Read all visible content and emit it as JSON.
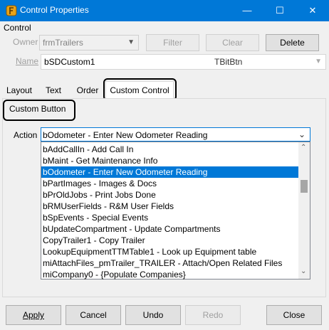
{
  "window": {
    "title": "Control Properties",
    "controls": {
      "minimize": "—",
      "maximize": "☐",
      "close": "✕"
    }
  },
  "control_group": {
    "label": "Control",
    "owner_label": "Owner",
    "owner_value": "frmTrailers",
    "filter_label": "Filter",
    "clear_label": "Clear",
    "delete_label": "Delete",
    "name_label": "Name",
    "name_value": "bSDCustom1",
    "type_value": "TBitBtn"
  },
  "tabs": [
    {
      "label": "Layout"
    },
    {
      "label": "Text"
    },
    {
      "label": "Order"
    },
    {
      "label": "Custom Control",
      "active": true
    }
  ],
  "custom": {
    "group_label": "Custom Button",
    "action_label": "Action",
    "action_value": "bOdometer - Enter New Odometer Reading",
    "options": [
      "bAddCallIn - Add Call In",
      "bMaint - Get Maintenance Info",
      "bOdometer - Enter New Odometer Reading",
      "bPartImages - Images & Docs",
      "bPrOldJobs - Print Jobs Done",
      "bRMUserFields - R&M User Fields",
      "bSpEvents - Special Events",
      "bUpdateCompartment - Update Compartments",
      "CopyTrailer1 - Copy Trailer",
      "LookupEquipmentTTMTable1 - Look up Equipment table",
      "miAttachFiles_pmTrailer_TRAILER - Attach/Open Related Files",
      "miCompany0 - {Populate Companies}"
    ],
    "selected_index": 2
  },
  "footer": {
    "apply_label": "Apply",
    "cancel_label": "Cancel",
    "undo_label": "Undo",
    "redo_label": "Redo",
    "close_label": "Close"
  },
  "colors": {
    "titlebar": "#0078d7",
    "selection": "#0078d7"
  }
}
